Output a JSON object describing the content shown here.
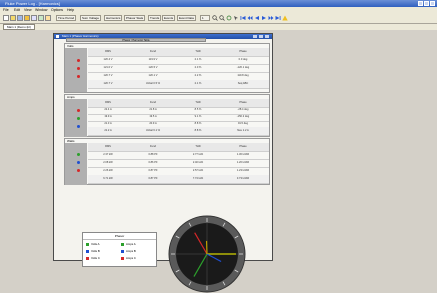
{
  "app": {
    "title": "Fluke Power Log - [Harmonics]"
  },
  "menu": [
    "File",
    "Edit",
    "View",
    "Window",
    "Options",
    "Help"
  ],
  "toolbar": {
    "buttons": [
      "Time Period",
      "Sum Voltage",
      "Harmonics",
      "Phasor Stats",
      "Trends",
      "Events",
      "Event Data"
    ],
    "zoom": "1"
  },
  "document_tab": "Main 1 (Demo.fpl)",
  "window": {
    "title": "Main 1 (Phasor Harmonics)"
  },
  "panel": {
    "header": "Phasor / Harmonic Table",
    "column_headers": [
      "RMS",
      "Fund",
      "THD",
      "Phase"
    ],
    "sections": [
      {
        "title": "Volts",
        "rows": [
          [
            "120.4 V",
            "119.9 V",
            "2.1 %",
            "0.0 deg"
          ],
          [
            "121.0 V",
            "120.5 V",
            "2.0 %",
            "-120.1 deg"
          ],
          [
            "120.7 V",
            "120.1 V",
            "2.2 %",
            "119.8 deg"
          ]
        ],
        "total": [
          "120.7 V",
          "Unbal 0.5 %",
          "2.1 %",
          "Seq ABC"
        ]
      },
      {
        "title": "Amps",
        "rows": [
          [
            "22.4 A",
            "21.8 A",
            "8.5 %",
            "-28.4 deg"
          ],
          [
            "19.9 A",
            "19.5 A",
            "9.1 %",
            "-150.2 deg"
          ],
          [
            "21.3 A",
            "20.9 A",
            "8.8 %",
            "91.5 deg"
          ]
        ],
        "total": [
          "21.2 A",
          "Unbal 6.1 %",
          "8.8 %",
          "Neu 1.2 A"
        ]
      },
      {
        "title": "Watts",
        "rows": [
          [
            "2.37 kW",
            "0.88 PF",
            "2.77 kVA",
            "1.30 kVAR"
          ],
          [
            "2.08 kW",
            "0.86 PF",
            "2.40 kVA",
            "1.20 kVAR"
          ],
          [
            "2.26 kW",
            "0.87 PF",
            "2.57 kVA",
            "1.23 kVAR"
          ]
        ],
        "total": [
          "6.71 kW",
          "0.87 PF",
          "7.74 kVA",
          "3.73 kVAR"
        ]
      }
    ]
  },
  "legend": {
    "title": "Phasor",
    "items": [
      {
        "label": "Volts A",
        "color": "#2ca02c"
      },
      {
        "label": "Amps A",
        "color": "#2ca02c"
      },
      {
        "label": "Volts B",
        "color": "#1f4fd0"
      },
      {
        "label": "Amps B",
        "color": "#1f4fd0"
      },
      {
        "label": "Volts C",
        "color": "#d62728"
      },
      {
        "label": "Amps C",
        "color": "#d62728"
      }
    ]
  },
  "phase_colors": {
    "A": "#d62728",
    "B": "#2ca02c",
    "C": "#1f4fd0"
  },
  "phasor": {
    "vectors": [
      {
        "name": "Volts A",
        "color": "#d4d400",
        "angle_deg": 0,
        "magnitude": 1.0
      },
      {
        "name": "Volts B",
        "color": "#2ca02c",
        "angle_deg": -120,
        "magnitude": 0.9
      },
      {
        "name": "Volts C",
        "color": "#d62728",
        "angle_deg": 120,
        "magnitude": 0.85
      },
      {
        "name": "Amps A",
        "color": "#1f4fd0",
        "angle_deg": -28,
        "magnitude": 0.55
      },
      {
        "name": "Amps C",
        "color": "#c0a000",
        "angle_deg": 92,
        "magnitude": 0.45
      }
    ]
  }
}
